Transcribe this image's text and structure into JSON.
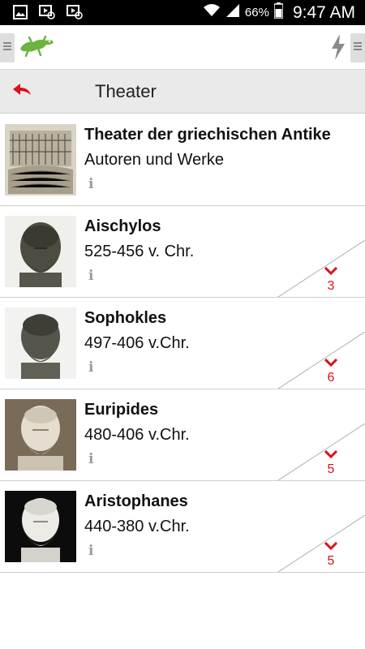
{
  "status_bar": {
    "battery": "66%",
    "time": "9:47 AM"
  },
  "header": {
    "title": "Theater"
  },
  "items": [
    {
      "title": "Theater der griechischen Antike",
      "subtitle": "Autoren und Werke",
      "count": ""
    },
    {
      "title": "Aischylos",
      "subtitle": "525-456 v. Chr.",
      "count": "3"
    },
    {
      "title": "Sophokles",
      "subtitle": "497-406 v.Chr.",
      "count": "6"
    },
    {
      "title": "Euripides",
      "subtitle": "480-406 v.Chr.",
      "count": "5"
    },
    {
      "title": "Aristophanes",
      "subtitle": "440-380 v.Chr.",
      "count": "5"
    }
  ],
  "info_glyph": "i",
  "colors": {
    "accent": "#d8121e",
    "lizard": "#6db33f",
    "header_bg": "#eaeaea",
    "statusbar_bg": "#000000"
  }
}
